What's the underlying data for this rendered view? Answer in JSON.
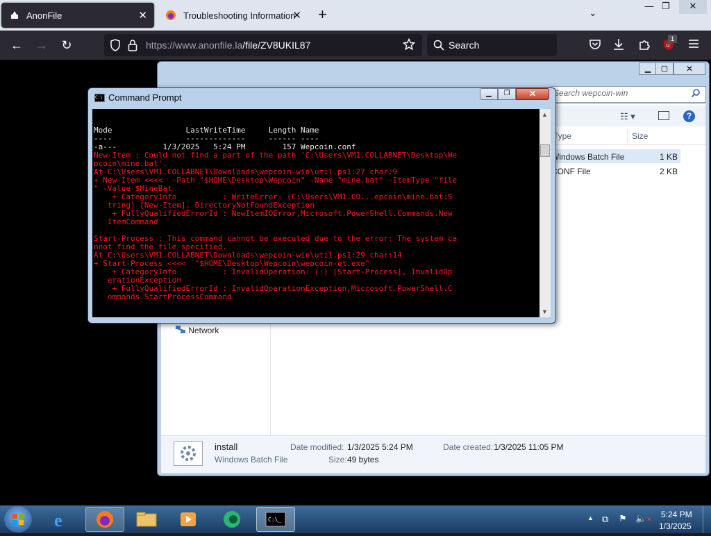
{
  "browser": {
    "tabs": [
      {
        "label": "AnonFile",
        "close": "✕"
      },
      {
        "label": "Troubleshooting Information",
        "close": "✕"
      }
    ],
    "new_tab": "+",
    "tab_list": "⌄",
    "url_host": "https://www.anonfile.la",
    "url_path": "/file/ZV8UKIL87",
    "search_placeholder": "Search",
    "extension_badge": "1"
  },
  "explorer": {
    "search_placeholder": "Search wepcoin-win",
    "columns": {
      "type": "Type",
      "size": "Size"
    },
    "files": [
      {
        "type": "Windows Batch File",
        "size": "1 KB"
      },
      {
        "type": "CONF File",
        "size": "2 KB"
      }
    ],
    "nav_network": "Network",
    "details": {
      "name": "install",
      "type": "Windows Batch File",
      "modified_label": "Date modified:",
      "modified_value": "1/3/2025 5:24 PM",
      "size_label": "Size:",
      "size_value": "49 bytes",
      "created_label": "Date created:",
      "created_value": "1/3/2025 11:05 PM"
    }
  },
  "cmd": {
    "title": "Command Prompt",
    "lines": [
      {
        "t": "Mode                LastWriteTime     Length Name",
        "c": "wt"
      },
      {
        "t": "----                -------------     ------ ----",
        "c": "wt"
      },
      {
        "t": "-a---          1/3/2025   5:24 PM        157 Wepcoin.conf",
        "c": "wt"
      },
      {
        "t": "New-Item : Could not find a part of the path 'C:\\Users\\VM1.COLLABNET\\Desktop\\We",
        "c": "rd"
      },
      {
        "t": "pcoin\\mine.bat'.",
        "c": "rd"
      },
      {
        "t": "At C:\\Users\\VM1.COLLABNET\\Downloads\\wepcoin-win\\util.ps1:27 char:9",
        "c": "rd"
      },
      {
        "t": "+ New-Item <<<<  -Path \"$HOME\\Desktop\\Wepcoin\" -Name \"mine.bat\" -ItemType \"file",
        "c": "rd"
      },
      {
        "t": "\" -Value $MineBat",
        "c": "rd"
      },
      {
        "t": "    + CategoryInfo          : WriteError: (C:\\Users\\VM1.CO...epcoin\\mine.bat:S",
        "c": "rd"
      },
      {
        "t": "   tring) [New-Item], DirectoryNotFoundException",
        "c": "rd"
      },
      {
        "t": "    + FullyQualifiedErrorId : NewItemIOError,Microsoft.PowerShell.Commands.New",
        "c": "rd"
      },
      {
        "t": "   ItemCommand",
        "c": "rd"
      },
      {
        "t": "",
        "c": "rd"
      },
      {
        "t": "Start-Process : This command cannot be executed due to the error: The system ca",
        "c": "rd"
      },
      {
        "t": "nnot find the file specified.",
        "c": "rd"
      },
      {
        "t": "At C:\\Users\\VM1.COLLABNET\\Downloads\\wepcoin-win\\util.ps1:29 char:14",
        "c": "rd"
      },
      {
        "t": "+ Start-Process <<<<  \"$HOME\\Desktop\\Wepcoin\\wepcoin-qt.exe\"",
        "c": "rd"
      },
      {
        "t": "    + CategoryInfo          : InvalidOperation: (:) [Start-Process], InvalidOp",
        "c": "rd"
      },
      {
        "t": "   erationException",
        "c": "rd"
      },
      {
        "t": "    + FullyQualifiedErrorId : InvalidOperationException,Microsoft.PowerShell.C",
        "c": "rd"
      },
      {
        "t": "   ommands.StartProcessCommand",
        "c": "rd"
      }
    ]
  },
  "taskbar": {
    "clock_time": "5:24 PM",
    "clock_date": "1/3/2025"
  },
  "colors": {
    "console_error": "#ff1515",
    "firefox_dark": "#2b2a33",
    "taskbar": "#1a3c63"
  }
}
